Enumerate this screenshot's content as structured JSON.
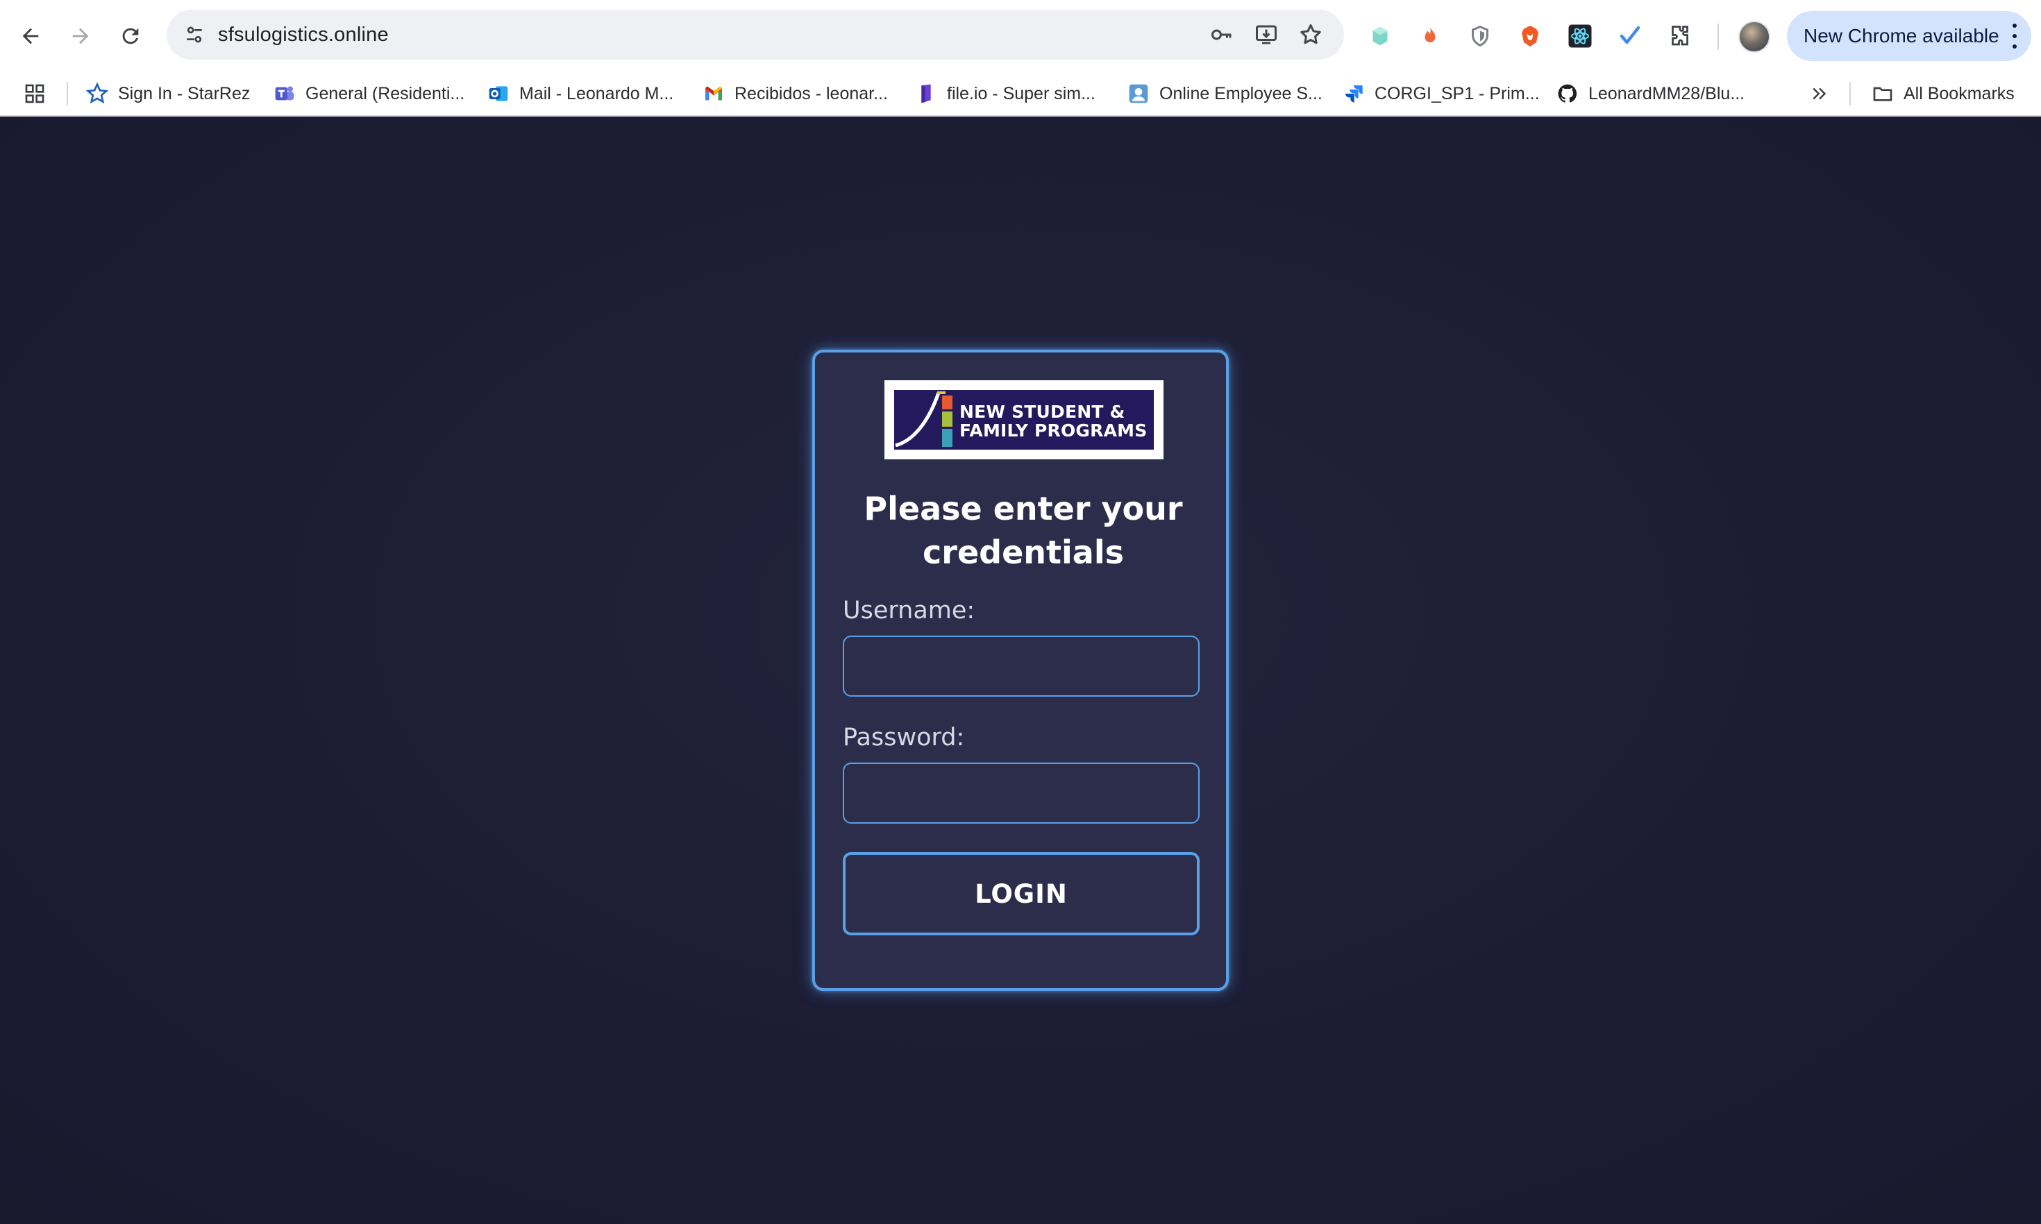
{
  "browser": {
    "url": "sfsulogistics.online",
    "update_label": "New Chrome available",
    "bookmarks": [
      {
        "label": "Sign In - StarRez",
        "icon": "star-icon"
      },
      {
        "label": "General (Residenti...",
        "icon": "teams-icon"
      },
      {
        "label": "Mail - Leonardo M...",
        "icon": "outlook-icon"
      },
      {
        "label": "Recibidos - leonar...",
        "icon": "gmail-icon"
      },
      {
        "label": "file.io - Super sim...",
        "icon": "fileio-icon"
      },
      {
        "label": "Online Employee S...",
        "icon": "employee-icon"
      },
      {
        "label": "CORGI_SP1 - Prim...",
        "icon": "jira-icon"
      },
      {
        "label": "LeonardMM28/Blu...",
        "icon": "github-icon"
      }
    ],
    "all_bookmarks_label": "All Bookmarks"
  },
  "login": {
    "logo_line1": "NEW STUDENT &",
    "logo_line2": "FAMILY PROGRAMS",
    "heading_line1": "Please enter your",
    "heading_line2": "credentials",
    "username_label": "Username:",
    "username_value": "",
    "password_label": "Password:",
    "password_value": "",
    "button_label": "LOGIN"
  },
  "colors": {
    "page_background": "#1c1c33",
    "card_background": "#2c2d4b",
    "accent": "#5aa0e8",
    "logo_navy": "#23195c",
    "update_pill": "#d3e3fd"
  }
}
